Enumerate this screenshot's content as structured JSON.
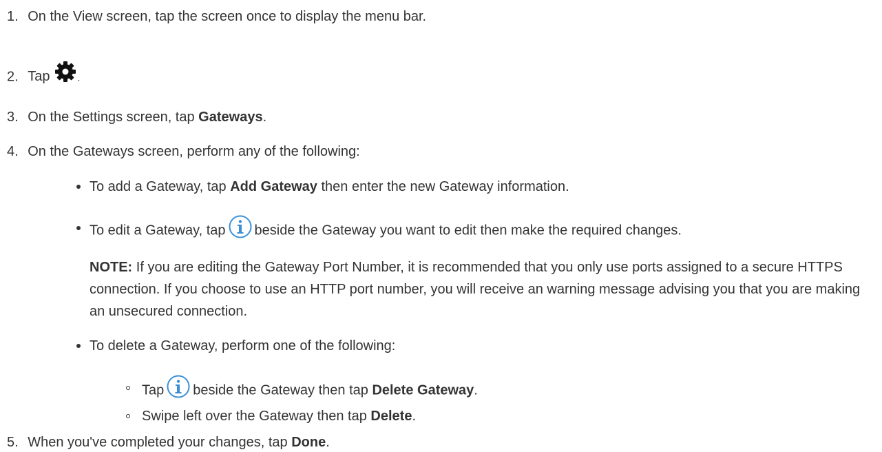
{
  "steps": {
    "s1": {
      "num": "1.",
      "text": "On the View screen, tap the screen once to display the menu bar."
    },
    "s2": {
      "num": "2.",
      "pre": "Tap",
      "post": ".",
      "icon": "gear-icon"
    },
    "s3": {
      "num": "3.",
      "pre": "On the Settings screen, tap ",
      "bold": "Gateways",
      "post": "."
    },
    "s4": {
      "num": "4.",
      "text": "On the Gateways screen, perform any of the following:"
    },
    "s5": {
      "num": "5.",
      "pre": "When you've completed your changes, tap ",
      "bold": "Done",
      "post": "."
    }
  },
  "bullets": {
    "add": {
      "pre": "To add a Gateway, tap ",
      "bold": "Add Gateway",
      "post": " then enter the new Gateway information."
    },
    "edit": {
      "pre": "To edit a Gateway, tap",
      "post": "beside the Gateway you want to edit then make the required changes.",
      "icon": "info-icon"
    },
    "delete": {
      "text": "To delete a Gateway, perform one of the following:"
    }
  },
  "note": {
    "label": "NOTE:",
    "text": " If you are editing the Gateway Port Number, it is recommended that you only use ports assigned to a secure HTTPS connection. If you choose to use an HTTP port number, you will receive an warning message advising you that you are making an unsecured connection."
  },
  "sub_bullets": {
    "tap_info": {
      "pre": "Tap",
      "post": "beside the Gateway then tap ",
      "bold": "Delete Gateway",
      "end": ".",
      "icon": "info-icon"
    },
    "swipe": {
      "pre": "Swipe left over the Gateway then tap ",
      "bold": "Delete",
      "end": "."
    }
  },
  "colors": {
    "text": "#333333",
    "info_icon": "#3a8fd8",
    "gear_icon": "#111111"
  }
}
